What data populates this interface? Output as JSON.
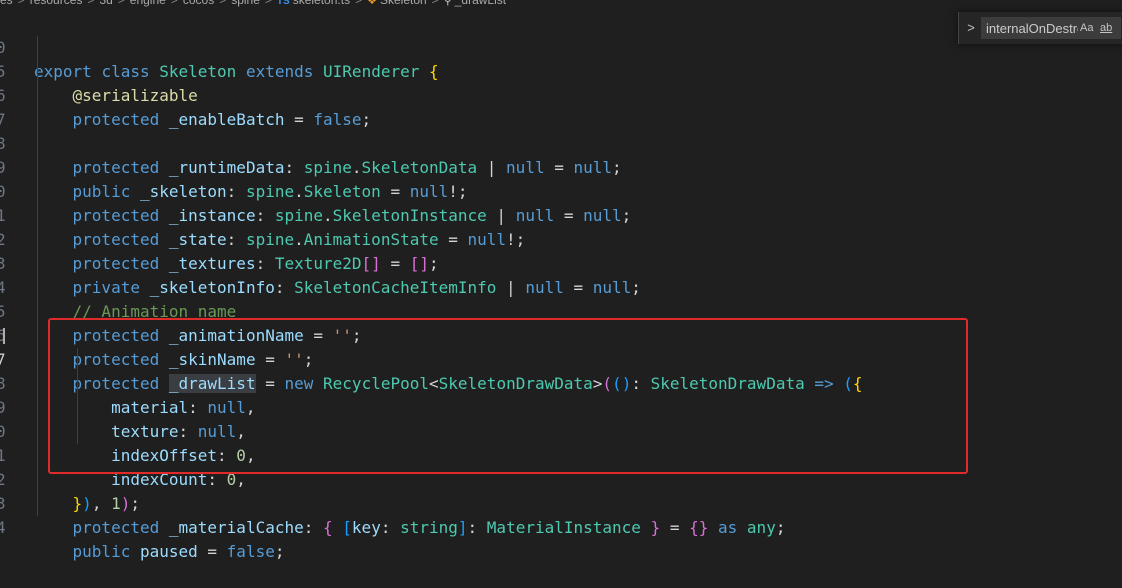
{
  "breadcrumb": [
    "es",
    "resources",
    "3d",
    "engine",
    "cocos",
    "spine",
    "skeleton.ts",
    "Skeleton",
    "_drawList"
  ],
  "breadcrumb_sep": ">",
  "ts_badge": "TS",
  "find": {
    "toggle": ">",
    "query": "internalOnDestroy",
    "match_case": "Aa",
    "whole_word": "ab"
  },
  "lines": {
    "l0": {
      "num": "0"
    },
    "l5": {
      "num": "5"
    },
    "l6": {
      "num": "6"
    },
    "l7": {
      "num": "7"
    },
    "l8": {
      "num": "8"
    },
    "l9": {
      "num": "9"
    },
    "l10": {
      "num": "0"
    },
    "l11": {
      "num": "1"
    },
    "l12": {
      "num": "2"
    },
    "l13": {
      "num": "3"
    },
    "l14": {
      "num": "4"
    },
    "l15": {
      "num": "5"
    },
    "l16": {
      "num": "6"
    },
    "l17": {
      "num": "7"
    },
    "l18": {
      "num": "8"
    },
    "l19": {
      "num": "9"
    },
    "l20": {
      "num": "0"
    },
    "l21": {
      "num": "1"
    },
    "l22": {
      "num": "2"
    },
    "l23": {
      "num": "3"
    },
    "l24": {
      "num": "4"
    }
  },
  "tok": {
    "export": "export",
    "class": "class",
    "Skeleton": "Skeleton",
    "extends": "extends",
    "UIRenderer": "UIRenderer",
    "lbrace": "{",
    "rbrace": "}",
    "serializable": "@serializable",
    "protected": "protected",
    "public": "public",
    "private": "private",
    "false": "false",
    "null": "null",
    "new": "new",
    "as": "as",
    "any": "any",
    "eq": " = ",
    "semi": ";",
    "colon": ": ",
    "pipe": " | ",
    "bang": "!;",
    "dot": ".",
    "enableBatch": "_enableBatch",
    "runtimeData": "_runtimeData",
    "skeleton": "_skeleton",
    "instance": "_instance",
    "state": "_state",
    "textures": "_textures",
    "skeletonInfo": "_skeletonInfo",
    "animationName": "_animationName",
    "skinName": "_skinName",
    "drawList": "_drawList",
    "materialCache": "_materialCache",
    "paused": "paused",
    "spine": "spine",
    "SkeletonData": "SkeletonData",
    "SkeletonInstance": "SkeletonInstance",
    "AnimationState": "AnimationState",
    "Texture2D": "Texture2D",
    "brackets": "[]",
    "SkeletonCacheItemInfo": "SkeletonCacheItemInfo",
    "comment": "// Animation name",
    "emptyStr": "''",
    "RecyclePool": "RecyclePool",
    "lt": "<",
    "gt": ">",
    "SkeletonDrawData": "SkeletonDrawData",
    "lparen": "(",
    "rparen": ")",
    "arrow": " => ",
    "material": "material",
    "texture": "texture",
    "indexOffset": "indexOffset",
    "indexCount": "indexCount",
    "comma": ",",
    "zero": "0",
    "one": "1",
    "key": "key",
    "string": "string",
    "lbrack": "[",
    "rbrack": "]",
    "MaterialInstance": "MaterialInstance",
    "emptyObj": "{}"
  },
  "colors": {
    "editor_bg": "#1f1f1f",
    "keyword": "#569cd6",
    "type": "#4ec9b0",
    "property": "#9cdcfe",
    "string": "#ce9178",
    "number": "#b5cea8",
    "comment": "#6a9955",
    "decorator": "#dcdcaa",
    "highlight_box": "#e12a2a"
  }
}
